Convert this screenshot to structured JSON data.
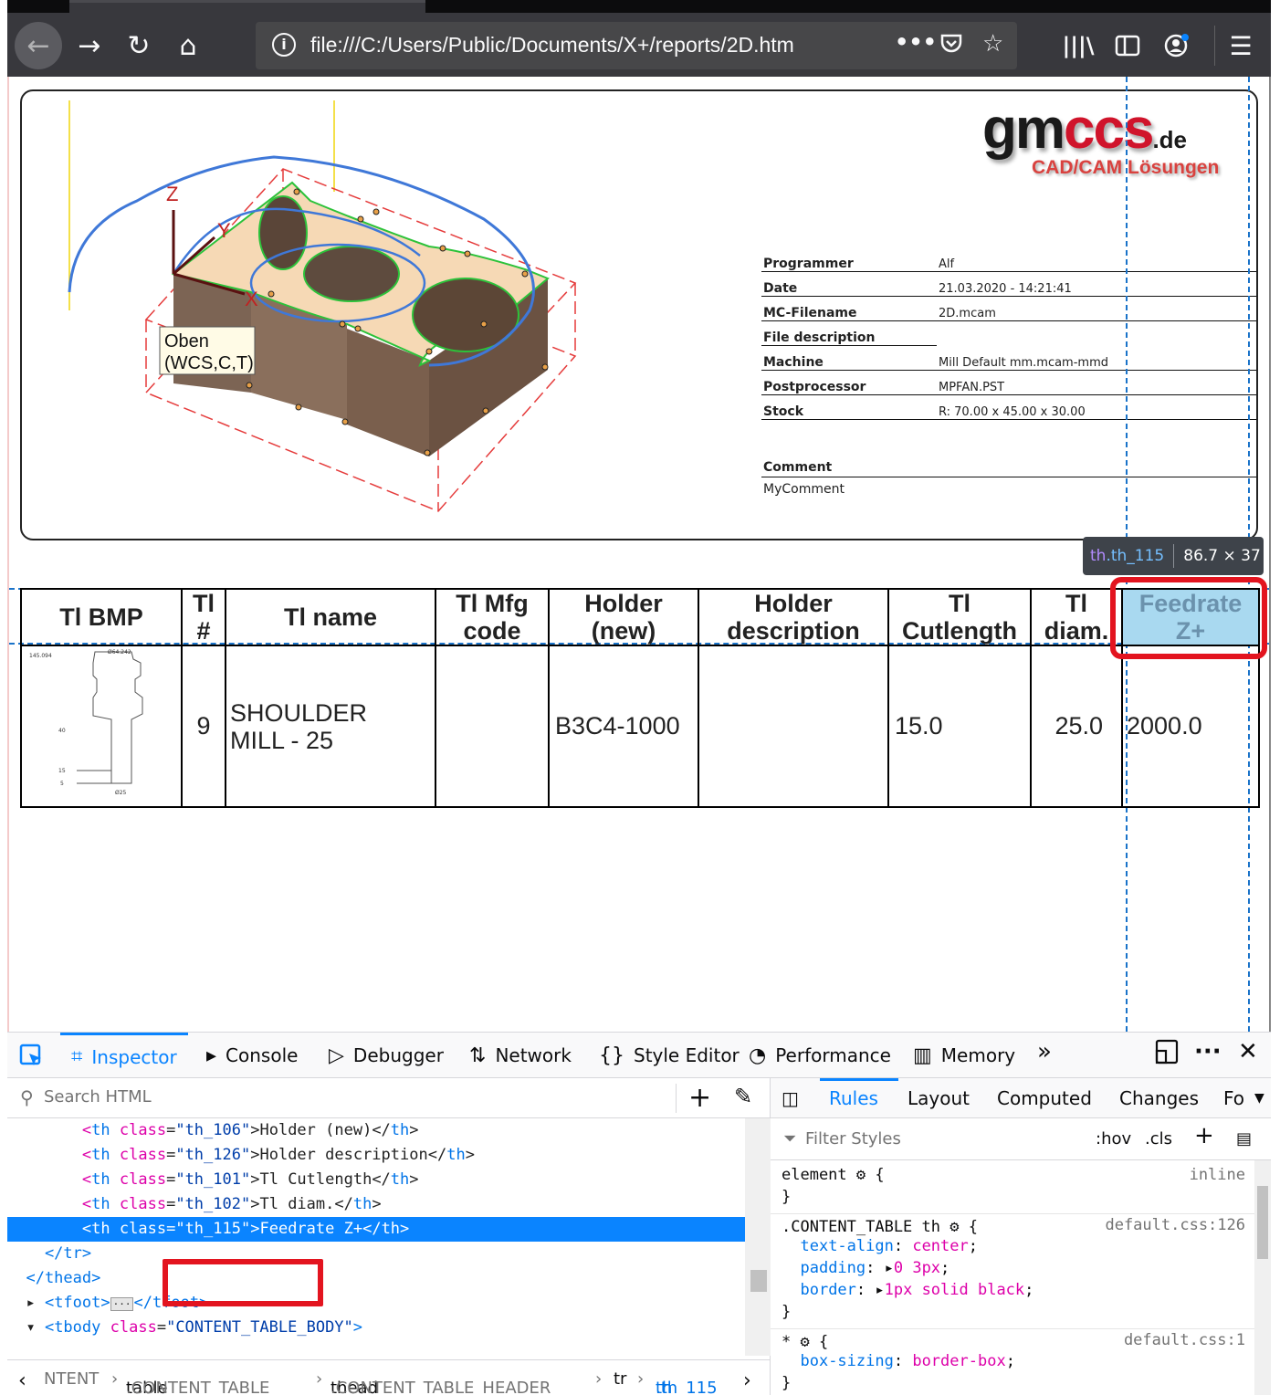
{
  "browser": {
    "url": "file:///C:/Users/Public/Documents/X+/reports/2D.htm",
    "page_actions": "•••"
  },
  "report": {
    "logo_main": "gm",
    "logo_red": "ccs",
    "logo_tld": ".de",
    "logo_tagline": "CAD/CAM Lösungen",
    "view_label_line1": "Oben",
    "view_label_line2": "(WCS,C,T)",
    "axis_x": "X",
    "axis_y": "Y",
    "axis_z": "Z",
    "info": [
      {
        "key": "Programmer",
        "value": "Alf"
      },
      {
        "key": "Date",
        "value": "21.03.2020 - 14:21:41"
      },
      {
        "key": "MC-Filename",
        "value": "2D.mcam"
      },
      {
        "key": "File description",
        "value": ""
      },
      {
        "key": "Machine",
        "value": "Mill Default mm.mcam-mmd"
      },
      {
        "key": "Postprocessor",
        "value": "MPFAN.PST"
      },
      {
        "key": "Stock",
        "value": "R: 70.00 x 45.00 x 30.00"
      }
    ],
    "comment_label": "Comment",
    "comment_value": "MyComment"
  },
  "inspector_tooltip": {
    "tag": "th",
    "class": ".th_115",
    "size": "86.7 × 37"
  },
  "tool_table": {
    "headers": [
      "Tl BMP",
      "Tl #",
      "Tl name",
      "Tl Mfg code",
      "Holder (new)",
      "Holder description",
      "Tl Cutlength",
      "Tl diam.",
      "Feedrate Z+"
    ],
    "header_lines": [
      [
        "Tl BMP"
      ],
      [
        "Tl",
        "#"
      ],
      [
        "Tl name"
      ],
      [
        "Tl Mfg",
        "code"
      ],
      [
        "Holder",
        "(new)"
      ],
      [
        "Holder",
        "description"
      ],
      [
        "Tl",
        "Cutlength"
      ],
      [
        "Tl",
        "diam."
      ],
      [
        "Feedrate",
        "Z+"
      ]
    ],
    "rows": [
      {
        "tl_no": "9",
        "tl_name_1": "SHOULDER",
        "tl_name_2": "MILL - 25",
        "mfg_code": "",
        "holder": "B3C4-1000",
        "holder_desc": "",
        "cutlength": "15.0",
        "diam": "25.0",
        "feedrate": "2000.0"
      }
    ],
    "bmp_labels": [
      "145.094",
      "Ø64.242",
      "40",
      "15",
      "5",
      "Ø25"
    ]
  },
  "devtools": {
    "tabs": [
      "Inspector",
      "Console",
      "Debugger",
      "Network",
      "Style Editor",
      "Performance",
      "Memory"
    ],
    "search_placeholder": "Search HTML",
    "markup_lines": [
      {
        "indent": "      ",
        "cls": "th_106",
        "text": "Holder (new)"
      },
      {
        "indent": "      ",
        "cls": "th_126",
        "text": "Holder description"
      },
      {
        "indent": "      ",
        "cls": "th_101",
        "text": "Tl Cutlength"
      },
      {
        "indent": "      ",
        "cls": "th_102",
        "text": "Tl diam."
      },
      {
        "indent": "      ",
        "cls": "th_115",
        "text": "Feedrate Z+"
      }
    ],
    "tr_close": "    </tr>",
    "thead_close": "  </thead>",
    "tfoot_line": "<tfoot>",
    "tfoot_close": "</tfoot>",
    "tbody_class": "CONTENT_TABLE_BODY",
    "breadcrumbs": [
      {
        "tag": "NTENT",
        "cls": ""
      },
      {
        "tag": "table",
        "cls": ".CONTENT_TABLE"
      },
      {
        "tag": "thead",
        "cls": ".CONTENT_TABLE_HEADER"
      },
      {
        "tag": "tr",
        "cls": ""
      },
      {
        "tag": "th",
        "cls": ".th_115"
      }
    ],
    "rules_tabs": [
      "Rules",
      "Layout",
      "Computed",
      "Changes",
      "Fo"
    ],
    "filter_placeholder": "Filter Styles",
    "hov": ":hov",
    "cls": ".cls",
    "css": {
      "element_selector": "element",
      "element_src": "inline",
      "rule1_selector": ".CONTENT_TABLE th",
      "rule1_src": "default.css:126",
      "rule1_props": [
        {
          "name": "text-align",
          "value": "center"
        },
        {
          "name": "padding",
          "value": "0 3px"
        },
        {
          "name": "border",
          "value": "1px solid black"
        }
      ],
      "rule2_selector": "*",
      "rule2_src": "default.css:1",
      "rule2_props": [
        {
          "name": "box-sizing",
          "value": "border-box"
        }
      ]
    }
  }
}
